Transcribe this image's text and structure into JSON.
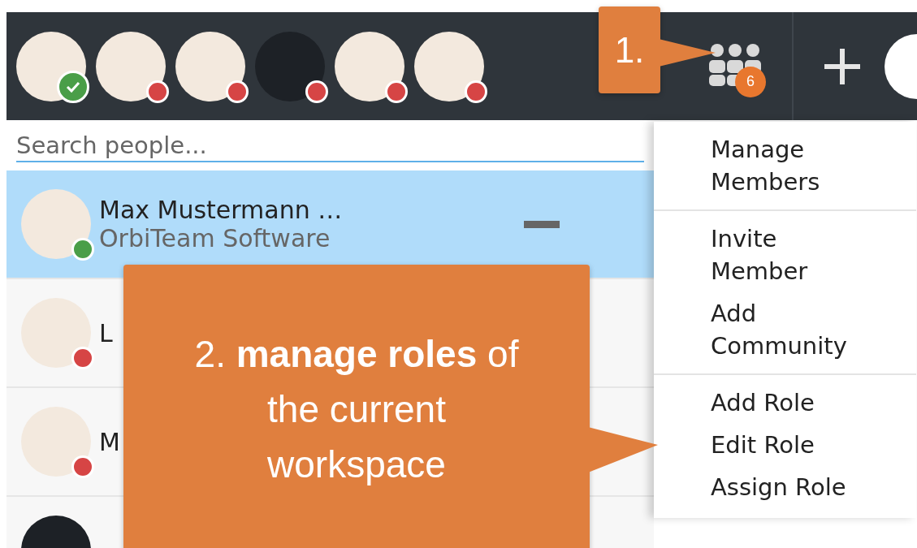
{
  "toolbar": {
    "avatars": [
      {
        "color": "#4a9e48",
        "checked": true
      },
      {
        "color": "#d64545",
        "checked": false
      },
      {
        "color": "#d64545",
        "checked": false
      },
      {
        "color": "#d64545",
        "checked": false
      },
      {
        "color": "#d64545",
        "checked": false
      },
      {
        "color": "#d64545",
        "checked": false
      }
    ],
    "members_badge": "6"
  },
  "callouts": [
    {
      "text": "1."
    },
    {
      "text": "2. **manage roles** of the current workspace"
    }
  ],
  "search": {
    "placeholder": "Search people..."
  },
  "people": [
    {
      "name": "Max Mustermann …",
      "organization": "OrbiTeam Software",
      "color": "#4a9e48",
      "selected": true
    },
    {
      "name": "L",
      "color": "#d64545",
      "selected": false
    },
    {
      "name": "M",
      "color": "#d64545",
      "selected": false
    },
    {
      "selected": false
    }
  ],
  "menu": {
    "groups": [
      [
        "Manage Members"
      ],
      [
        "Invite Member",
        "Add Community"
      ],
      [
        "Add Role",
        "Edit Role",
        "Assign Role"
      ]
    ]
  }
}
